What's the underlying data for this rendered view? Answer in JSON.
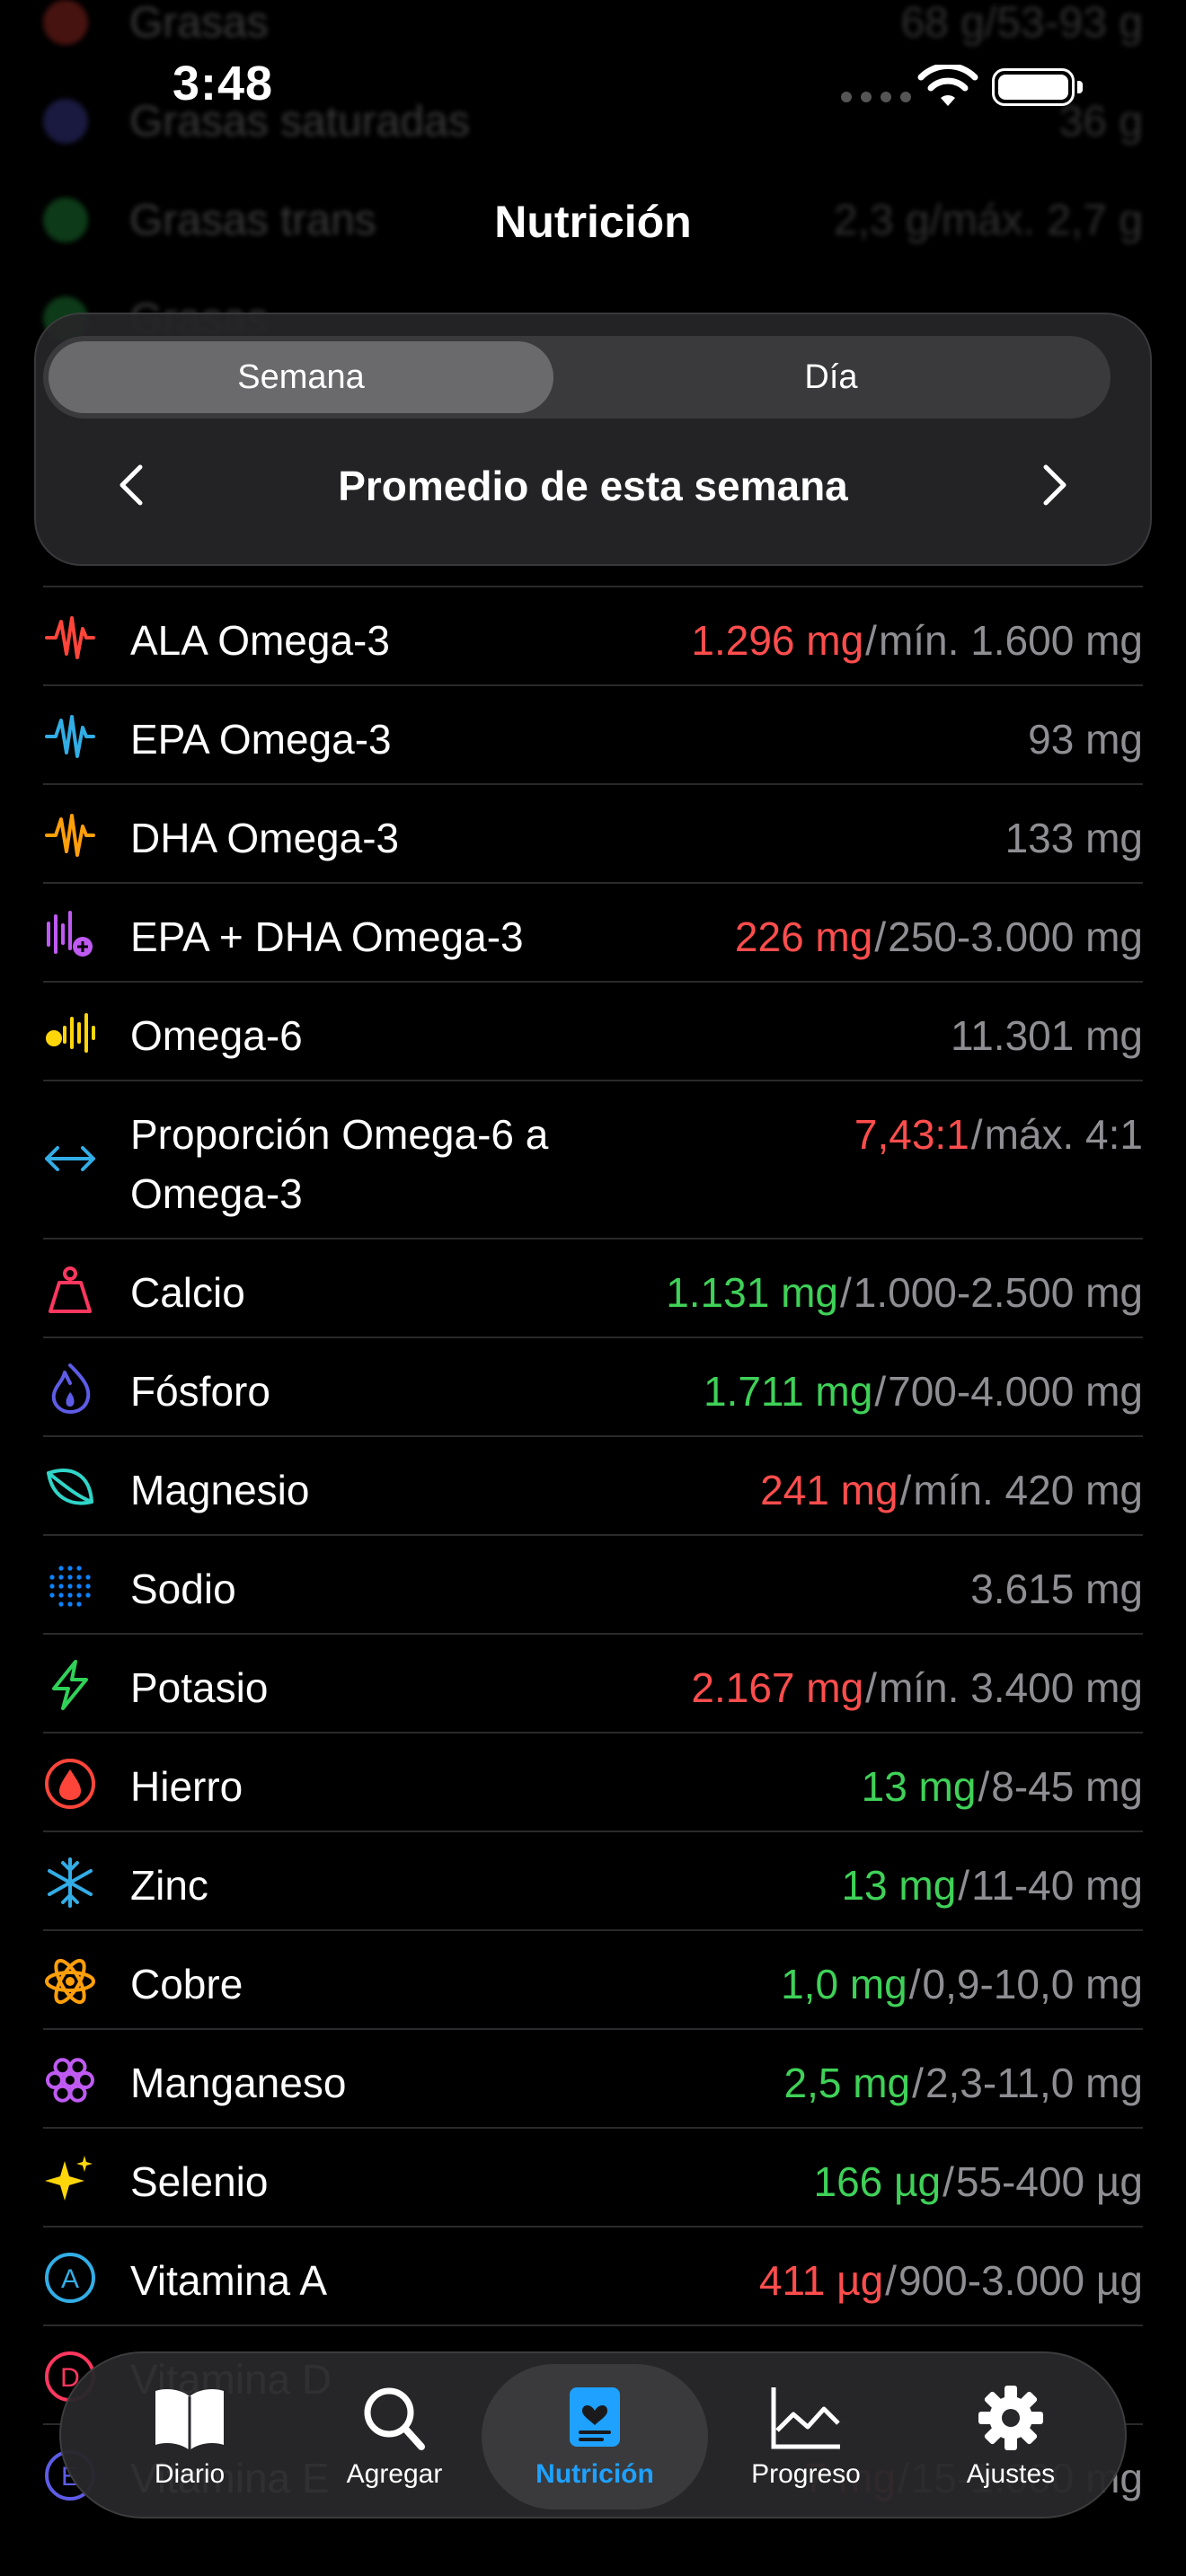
{
  "status_bar": {
    "time": "3:48"
  },
  "header": {
    "title": "Nutrición"
  },
  "segmented": {
    "options": [
      "Semana",
      "Día"
    ],
    "selected": "Semana"
  },
  "period": {
    "label": "Promedio de esta semana"
  },
  "background_rows": [
    {
      "name": "Grasas",
      "value": "68 g/53-93 g"
    },
    {
      "name": "Grasas saturadas",
      "value": "36 g"
    },
    {
      "name": "Grasas trans",
      "value": "2,3 g/máx. 2,7 g"
    },
    {
      "name": "Grasas",
      "value": ""
    }
  ],
  "nutrients": [
    {
      "name": "ALA Omega-3",
      "amount": "1.296 mg",
      "status": "red",
      "target": "mín. 1.600 mg",
      "icon": "waveform-icon",
      "color": "#ff453a"
    },
    {
      "name": "EPA Omega-3",
      "amount": "93 mg",
      "status": "gray",
      "target": "",
      "icon": "waveform-icon",
      "color": "#32ade6"
    },
    {
      "name": "DHA Omega-3",
      "amount": "133 mg",
      "status": "gray",
      "target": "",
      "icon": "waveform-icon",
      "color": "#ff9f0a"
    },
    {
      "name": "EPA + DHA Omega-3",
      "amount": "226 mg",
      "status": "red",
      "target": "250-3.000 mg",
      "icon": "waveform-plus-icon",
      "color": "#bf5af2"
    },
    {
      "name": "Omega-6",
      "amount": "11.301 mg",
      "status": "gray",
      "target": "",
      "icon": "waveform-dot-icon",
      "color": "#ffd60a"
    },
    {
      "name": "Proporción Omega-6 a Omega-3",
      "amount": "7,43:1",
      "status": "red",
      "target": "máx. 4:1",
      "icon": "arrow-left-right-icon",
      "color": "#32ade6"
    },
    {
      "name": "Calcio",
      "amount": "1.131 mg",
      "status": "green",
      "target": "1.000-2.500 mg",
      "icon": "scale-weight-icon",
      "color": "#ff375f"
    },
    {
      "name": "Fósforo",
      "amount": "1.711 mg",
      "status": "green",
      "target": "700-4.000 mg",
      "icon": "flame-icon",
      "color": "#5e5ce6"
    },
    {
      "name": "Magnesio",
      "amount": "241 mg",
      "status": "red",
      "target": "mín. 420 mg",
      "icon": "leaf-icon",
      "color": "#30d5c8"
    },
    {
      "name": "Sodio",
      "amount": "3.615 mg",
      "status": "gray",
      "target": "",
      "icon": "dots-circle-icon",
      "color": "#0a84ff"
    },
    {
      "name": "Potasio",
      "amount": "2.167 mg",
      "status": "red",
      "target": "mín. 3.400 mg",
      "icon": "bolt-icon",
      "color": "#30d158"
    },
    {
      "name": "Hierro",
      "amount": "13 mg",
      "status": "green",
      "target": "8-45 mg",
      "icon": "drop-icon",
      "color": "#ff453a"
    },
    {
      "name": "Zinc",
      "amount": "13 mg",
      "status": "green",
      "target": "11-40 mg",
      "icon": "snowflake-icon",
      "color": "#32ade6"
    },
    {
      "name": "Cobre",
      "amount": "1,0 mg",
      "status": "green",
      "target": "0,9-10,0 mg",
      "icon": "atom-icon",
      "color": "#ff9f0a"
    },
    {
      "name": "Manganeso",
      "amount": "2,5 mg",
      "status": "green",
      "target": "2,3-11,0 mg",
      "icon": "flower-icon",
      "color": "#bf5af2"
    },
    {
      "name": "Selenio",
      "amount": "166 µg",
      "status": "green",
      "target": "55-400 µg",
      "icon": "sparkles-icon",
      "color": "#ffd60a"
    },
    {
      "name": "Vitamina A",
      "amount": "411 µg",
      "status": "red",
      "target": "900-3.000 µg",
      "icon": "letter-a-circle-icon",
      "color": "#32ade6"
    },
    {
      "name": "Vitamina D",
      "amount": "",
      "status": "red",
      "target": "",
      "icon": "letter-d-circle-icon",
      "color": "#ff375f"
    },
    {
      "name": "Vitamina E",
      "amount": "7 mg",
      "status": "red",
      "target": "15-1.000 mg",
      "icon": "letter-e-circle-icon",
      "color": "#5e5ce6"
    }
  ],
  "tabbar": {
    "tabs": [
      {
        "label": "Diario",
        "icon": "book-icon"
      },
      {
        "label": "Agregar",
        "icon": "search-icon"
      },
      {
        "label": "Nutrición",
        "icon": "nutrition-icon"
      },
      {
        "label": "Progreso",
        "icon": "chart-line-icon"
      },
      {
        "label": "Ajustes",
        "icon": "gear-icon"
      }
    ],
    "selected": "Nutrición",
    "accent": "#1ea1ff"
  }
}
